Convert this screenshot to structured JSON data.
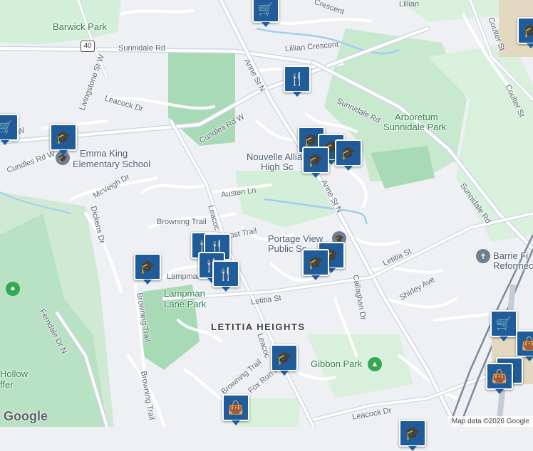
{
  "map": {
    "street_labels": {
      "sunnidale_rd_top": "Sunnidale Rd",
      "lillian_crescent": "Lillian Crescent",
      "crescent_top": "Crescent",
      "lillian_top": "Lillian",
      "anne_st_n_north": "Anne St N",
      "anne_st_n_south": "Anne St N",
      "livingstone_st_w": "Livingstone St W",
      "leacock_dr_north": "Leacock Dr",
      "cundles_rd_w": "Cundles Rd W",
      "cundles_rd_w_left": "Cundles Rd W",
      "st_w_left": "e St W",
      "mcveigh_dr": "McVeigh Dr",
      "dickens_dr": "Dickens Dr",
      "austen_ln": "Austen Ln",
      "browning_trail_mid": "Browning Trail",
      "leacock_vertical_mid": "Leacoc",
      "lost_trail": "ost Trail",
      "lampman": "Lampman",
      "letitia_st_west": "Letitia St",
      "letitia_st_east": "Letitia St",
      "callaghan_dr": "Callaghan Dr",
      "shirley_ave": "Shirley Ave",
      "sunnidale_rd_mid": "Sunnidale Rd",
      "sunnidale_rd_right": "Sunnidale Rd",
      "coulter_st_top": "Coulter St",
      "coulter_st_mid": "Coulter St",
      "ferndale_dr_n": "Ferndale Dr N",
      "browning_trail_vertical": "Browning Trail",
      "browning_trail_bottom": "Browning Trail",
      "browning_trail_lower": "Browning Trail",
      "leacock_vertical_south": "Leacoc",
      "fox_run": "Fox Run D",
      "leacock_dr_south": "Leacock Dr"
    },
    "place_labels": {
      "barwick_park": "Barwick Park",
      "arboretum": [
        "Arboretum",
        "Sunnidale Park"
      ],
      "emma_king": [
        "Emma King",
        "Elementary School"
      ],
      "nouvelle_alliance": [
        "Nouvelle Allia",
        "High Sc"
      ],
      "portage_view": [
        "Portage View",
        "Public Sc"
      ],
      "lampman_lane_park": [
        "Lampman",
        "Lane Park"
      ],
      "letitia_heights": "LETITIA HEIGHTS",
      "gibbon_park": "Gibbon Park",
      "barrie_fi": [
        "Barrie Fi",
        "Reformec"
      ],
      "hollow": [
        "Hollow",
        "ffer"
      ]
    },
    "markers": [
      {
        "name": "shopping-cart-marker-top",
        "icon": "shopping-cart-icon",
        "glyph": "🛒"
      },
      {
        "name": "restaurant-marker-anne",
        "icon": "restaurant-icon",
        "glyph": "🍴"
      },
      {
        "name": "school-marker-emma-king",
        "icon": "graduation-cap-icon",
        "glyph": "🎓"
      },
      {
        "name": "school-marker-nouvelle-1",
        "icon": "graduation-cap-icon",
        "glyph": "🎓"
      },
      {
        "name": "school-marker-nouvelle-2",
        "icon": "graduation-cap-icon",
        "glyph": "🎓"
      },
      {
        "name": "school-marker-nouvelle-3",
        "icon": "graduation-cap-icon",
        "glyph": "🎓"
      },
      {
        "name": "school-marker-nouvelle-4",
        "icon": "graduation-cap-icon",
        "glyph": "🎓"
      },
      {
        "name": "school-marker-lampman",
        "icon": "graduation-cap-icon",
        "glyph": "🎓"
      },
      {
        "name": "restaurant-marker-leacock-1",
        "icon": "restaurant-icon",
        "glyph": "🍴"
      },
      {
        "name": "restaurant-marker-leacock-2",
        "icon": "restaurant-icon",
        "glyph": "🍴"
      },
      {
        "name": "restaurant-marker-leacock-3",
        "icon": "restaurant-icon",
        "glyph": "🍴"
      },
      {
        "name": "restaurant-marker-leacock-4",
        "icon": "restaurant-icon",
        "glyph": "🍴"
      },
      {
        "name": "school-marker-portage-1",
        "icon": "graduation-cap-icon",
        "glyph": "🎓"
      },
      {
        "name": "school-marker-portage-2",
        "icon": "graduation-cap-icon",
        "glyph": "🎓"
      },
      {
        "name": "school-marker-fox-run",
        "icon": "graduation-cap-icon",
        "glyph": "🎓"
      },
      {
        "name": "shopping-bag-marker-bottom",
        "icon": "shopping-bag-icon",
        "glyph": "👜"
      },
      {
        "name": "shopping-cart-marker-right",
        "icon": "shopping-cart-icon",
        "glyph": "🛒"
      },
      {
        "name": "shopping-bag-marker-right",
        "icon": "shopping-bag-icon",
        "glyph": "👜"
      },
      {
        "name": "parking-marker-right",
        "icon": "parking-icon",
        "glyph": "P"
      },
      {
        "name": "shopping-bag-marker-right-2",
        "icon": "shopping-bag-icon",
        "glyph": "👜"
      },
      {
        "name": "shopping-cart-marker-left-edge",
        "icon": "shopping-cart-icon",
        "glyph": "🛒"
      },
      {
        "name": "school-marker-top-right",
        "icon": "graduation-cap-icon",
        "glyph": "🎓"
      },
      {
        "name": "school-marker-bottom-right",
        "icon": "graduation-cap-icon",
        "glyph": "🎓"
      }
    ],
    "route_shield": "40",
    "google_logo": "Google",
    "attribution": "Map data ©2026 Google",
    "colors": {
      "background": "#eef0f3",
      "park": "#c9e9cf",
      "park_dark": "#a8dab6",
      "road": "#ffffff",
      "arterial": "#cfd8e3",
      "water": "#9dd0f0",
      "marker": "#1f5c99",
      "rail": "#7d8a99"
    }
  }
}
